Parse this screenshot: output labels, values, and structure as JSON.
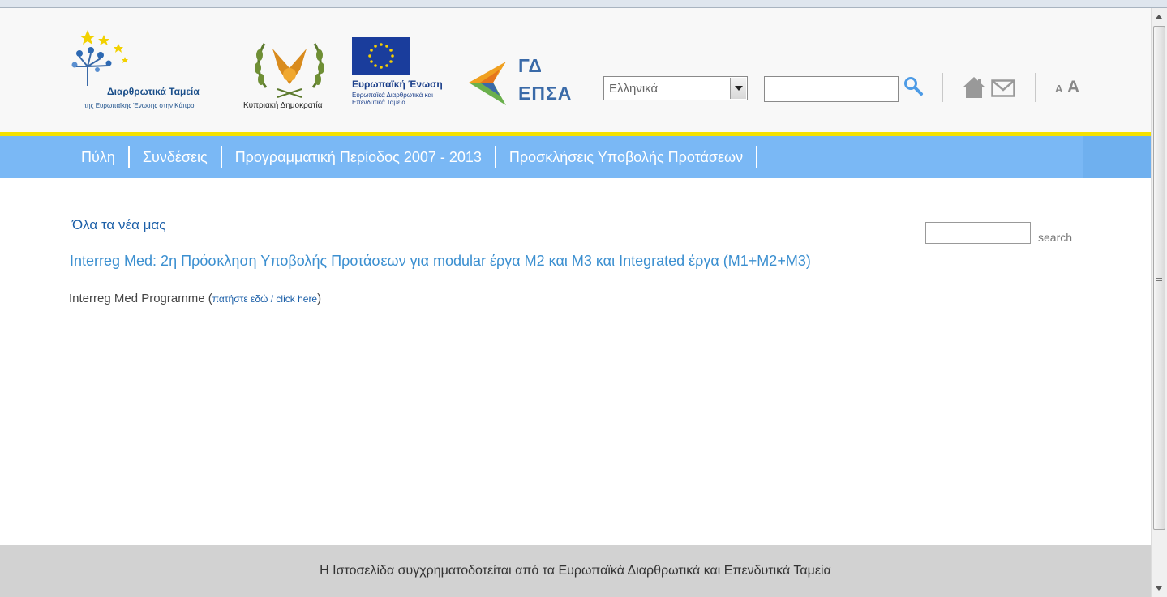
{
  "header": {
    "logo_structural_funds": {
      "title": "Διαρθρωτικά Ταμεία",
      "subtitle": "της Ευρωπαϊκής Ένωσης στην Κύπρο"
    },
    "logo_cyprus": {
      "caption": "Κυπριακή Δημοκρατία"
    },
    "logo_eu": {
      "title": "Ευρωπαϊκή Ένωση",
      "subtitle": "Ευρωπαϊκά Διαρθρωτικά και Επενδυτικά Ταμεία"
    },
    "logo_gd": {
      "line1": "ΓΔ",
      "line2": "ΕΠΣΑ"
    },
    "language_select": {
      "value": "Ελληνικά"
    },
    "search": {
      "value": ""
    },
    "font_small_label": "A",
    "font_large_label": "A"
  },
  "nav": {
    "items": [
      {
        "label": "Πύλη"
      },
      {
        "label": "Συνδέσεις"
      },
      {
        "label": "Προγραμματική Περίοδος 2007 - 2013"
      },
      {
        "label": "Προσκλήσεις Υποβολής Προτάσεων"
      }
    ]
  },
  "content": {
    "all_news_link": "Όλα τα νέα μας",
    "search_label": "search",
    "article": {
      "title": "Interreg Med: 2η Πρόσκληση Υποβολής Προτάσεων για modular έργα M2 και M3 και Integrated έργα (M1+M2+M3)",
      "body_prefix": "Interreg Med Programme (",
      "body_link": "πατήστε εδώ / click here",
      "body_suffix": ")"
    }
  },
  "footer": {
    "text": "Η Ιστοσελίδα συγχρηματοδοτείται από τα Ευρωπαϊκά Διαρθρωτικά και Επενδυτικά Ταμεία"
  },
  "colors": {
    "nav_bg": "#7ab8f5",
    "header_rule": "#f5e100",
    "link": "#1b5fa8",
    "article_title": "#3b8fd0",
    "footer_bg": "#d2d2d2"
  }
}
